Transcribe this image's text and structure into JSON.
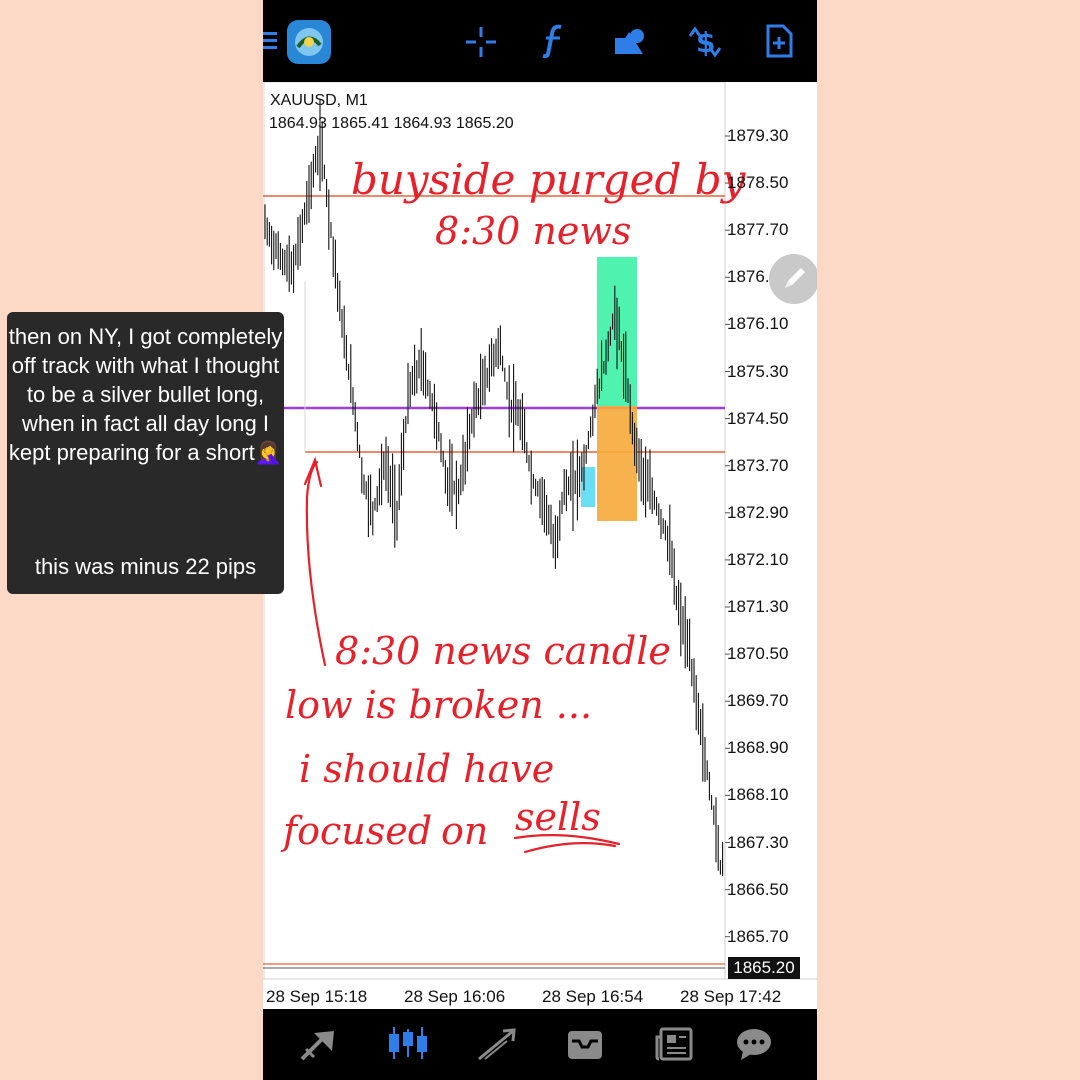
{
  "toolbar": {
    "icons": [
      "menu-icon",
      "metatrader-logo-icon",
      "crosshair-icon",
      "indicators-icon",
      "objects-icon",
      "trade-icon",
      "new-order-icon"
    ]
  },
  "chart": {
    "symbol": "XAUUSD, M1",
    "ohlc": "1864.93 1865.41 1864.93 1865.20",
    "current_price": "1865.20",
    "y_ticks": [
      "1879.30",
      "1878.50",
      "1877.70",
      "1876.90",
      "1876.10",
      "1875.30",
      "1874.50",
      "1873.70",
      "1872.90",
      "1872.10",
      "1871.30",
      "1870.50",
      "1869.70",
      "1868.90",
      "1868.10",
      "1867.30",
      "1866.50",
      "1865.70"
    ],
    "x_ticks": [
      "28 Sep 15:18",
      "28 Sep 16:06",
      "28 Sep 16:54",
      "28 Sep 17:42"
    ],
    "annotations": {
      "top_line1": "buyside purged by",
      "top_line2": "8:30 news",
      "bottom_line1": "8:30 news candle",
      "bottom_line2": "low is broken ...",
      "bottom_line3": "i should have",
      "bottom_line4a": "focused",
      "bottom_line4b": "on",
      "bottom_line4c": "sells"
    },
    "colors": {
      "buyside_line": "#e8643c",
      "mid_line": "#9b40d8",
      "handwriting": "#e8202a",
      "profit_zone": "#3cf2a6",
      "loss_zone": "#f6a93a",
      "entry_marker": "#4fd8f2"
    }
  },
  "caption": {
    "text1": "then on NY, I got completely off track with what I thought to be a silver bullet long, when in fact all day long I kept preparing for a short🤦‍♀️",
    "text2": "this was minus 22 pips"
  },
  "bottom_nav": {
    "icons": [
      "quotes-icon",
      "chart-icon",
      "trade-icon",
      "history-icon",
      "news-icon",
      "messages-icon"
    ]
  }
}
